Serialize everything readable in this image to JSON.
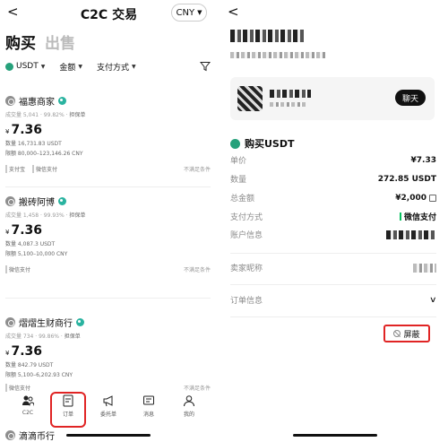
{
  "left": {
    "header": {
      "back": "<",
      "title": "C2C 交易",
      "currency": "CNY"
    },
    "tabs": {
      "buy": "购买",
      "sell": "出售"
    },
    "filters": {
      "coin": "USDT",
      "amount": "金额",
      "payment": "支付方式"
    },
    "merchants": [
      {
        "name": "福惠商家",
        "stats": "成交量 5,041 · 99.82% · ",
        "stamp": "担保单",
        "currency_symbol": "¥",
        "price": "7.36",
        "quantity": "数量  16,731.83 USDT",
        "limit": "限额  80,000–123,146.26 CNY",
        "payments": [
          "支付宝",
          "微信支付"
        ],
        "status": "不满足条件"
      },
      {
        "name": "搬砖阿博",
        "stats": "成交量 1,458 · 99.93% · ",
        "stamp": "担保单",
        "currency_symbol": "¥",
        "price": "7.36",
        "quantity": "数量  4,087.3 USDT",
        "limit": "限额  5,100–10,000 CNY",
        "payments": [
          "微信支付"
        ],
        "status": "不满足条件"
      },
      {
        "name": "熠熠生财商行",
        "stats": "成交量 734 · 99.86% · ",
        "stamp": "担保单",
        "currency_symbol": "¥",
        "price": "7.36",
        "quantity": "数量  842.79 USDT",
        "limit": "限额  5,100–6,202.93 CNY",
        "payments": [
          "微信支付"
        ],
        "status": "不满足条件"
      }
    ],
    "peek_merchant": "滴滴币行",
    "bottom_nav": [
      {
        "label": "C2C",
        "icon": "people-icon"
      },
      {
        "label": "订单",
        "icon": "order-icon"
      },
      {
        "label": "委托单",
        "icon": "megaphone-icon"
      },
      {
        "label": "消息",
        "icon": "message-icon"
      },
      {
        "label": "我的",
        "icon": "profile-icon"
      }
    ]
  },
  "right": {
    "back": "<",
    "chat": "聊天",
    "order_title": "购买USDT",
    "rows": {
      "unit_price": {
        "label": "单价",
        "value": "¥7.33"
      },
      "quantity": {
        "label": "数量",
        "value": "272.85 USDT"
      },
      "total": {
        "label": "总金额",
        "value": "¥2,000"
      },
      "payment": {
        "label": "支付方式",
        "value": "微信支付"
      },
      "account": {
        "label": "账户信息"
      },
      "seller_nick": {
        "label": "卖家昵称"
      },
      "order_info": {
        "label": "订单信息"
      }
    },
    "block": "屏蔽"
  },
  "colors": {
    "accent_red": "#e02424",
    "usdt_green": "#26a17b",
    "wechat_green": "#07c160"
  }
}
